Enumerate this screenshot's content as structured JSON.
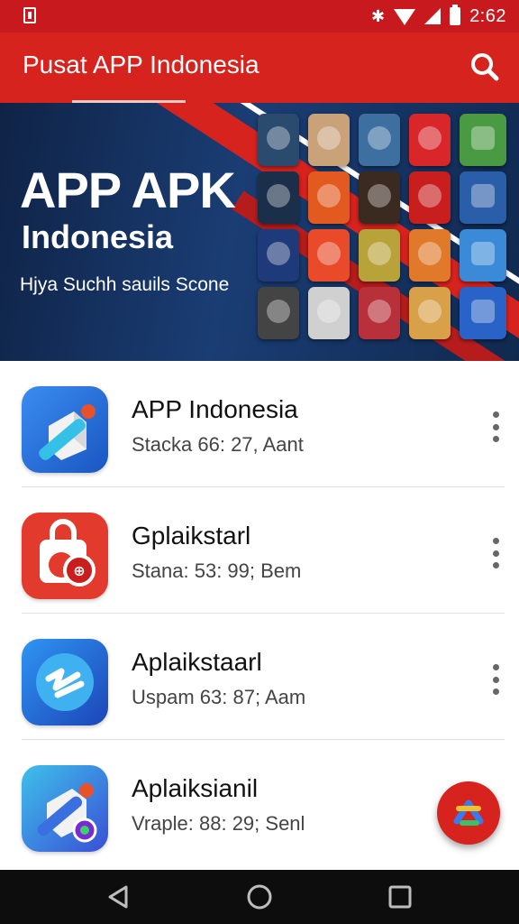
{
  "status_bar": {
    "time": "2:62",
    "icons": [
      "app-notification-icon",
      "bluetooth-icon",
      "wifi-icon",
      "signal-icon",
      "battery-icon"
    ]
  },
  "app_bar": {
    "title": "Pusat APP Indonesia",
    "search_icon": "search-icon"
  },
  "banner": {
    "title": "APP APK",
    "subtitle": "Indonesia",
    "tagline": "Hjya Suchh sauils Scone",
    "tile_colors": [
      "#2a4a6e",
      "#c9a27a",
      "#3d6fa0",
      "#d9262a",
      "#4a9a44",
      "#1b2f4a",
      "#e25a1f",
      "#3a2a20",
      "#c81e1e",
      "#2b5ea8",
      "#1e3a7a",
      "#e84a2a",
      "#b8a23a",
      "#e07a2a",
      "#3a8ad8",
      "#444444",
      "#d0d0d0",
      "#b8303a",
      "#d8a048",
      "#2a63c8",
      "#2a4f86",
      "#3a2a2a",
      "#2f6fb8",
      "#e0902a",
      "#9a7a5a"
    ]
  },
  "apps": [
    {
      "name": "APP Indonesia",
      "meta": "Stacka 66: 27, Aant",
      "icon": "app-indonesia-icon",
      "colors": [
        "#2d7fe0",
        "#1a5cc4"
      ]
    },
    {
      "name": "Gplaikstarl",
      "meta": "Stana: 53: 99; Bem",
      "icon": "shopping-bag-icon",
      "colors": [
        "#e8392b",
        "#c81e1e"
      ]
    },
    {
      "name": "Aplaikstaarl",
      "meta": "Uspam 63: 87; Aam",
      "icon": "aplaikstaarl-icon",
      "colors": [
        "#2d8ff0",
        "#1e4fc0"
      ]
    },
    {
      "name": "Aplaiksianil",
      "meta": "Vraple: 88: 29; Senl",
      "icon": "aplaiksianil-icon",
      "colors": [
        "#38b8e8",
        "#3a5fd8"
      ]
    }
  ],
  "fab": {
    "icon": "refresh-icon",
    "color": "#d7231e"
  },
  "nav_bar": {
    "buttons": [
      "back-icon",
      "home-icon",
      "recents-icon"
    ]
  },
  "colors": {
    "primary": "#d7231e",
    "status_bar": "#c8191f",
    "banner_bg": "#12284f"
  }
}
